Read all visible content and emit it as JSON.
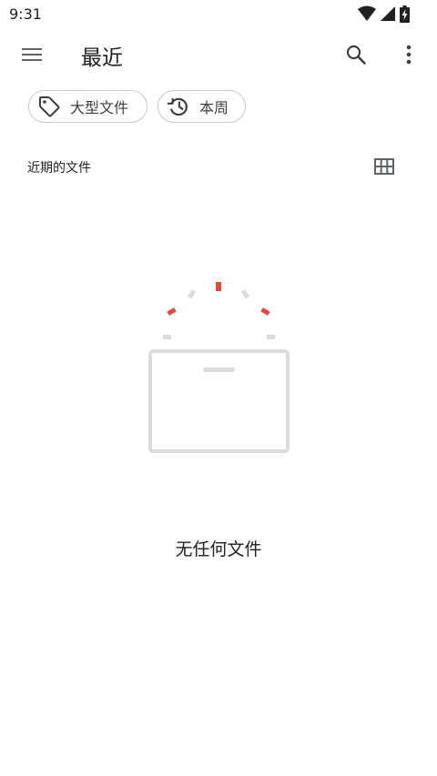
{
  "status_bar": {
    "time": "9:31",
    "icons": [
      "wifi-icon",
      "cellular-signal-icon",
      "battery-charging-icon"
    ]
  },
  "app_bar": {
    "menu_icon": "hamburger-menu-icon",
    "title": "最近",
    "search_icon": "search-icon",
    "more_icon": "more-vert-icon"
  },
  "filters": [
    {
      "label": "大型文件",
      "icon": "tag-icon"
    },
    {
      "label": "本周",
      "icon": "history-icon"
    }
  ],
  "section": {
    "label": "近期的文件",
    "view_toggle_icon": "grid-view-icon"
  },
  "empty_state": {
    "message": "无任何文件",
    "illustration": "empty-folder-illustration"
  },
  "colors": {
    "accent_red": "#e8453c",
    "illustration_gray": "#dadce0",
    "chip_border": "#c7c9cc",
    "text_primary": "#202124"
  }
}
